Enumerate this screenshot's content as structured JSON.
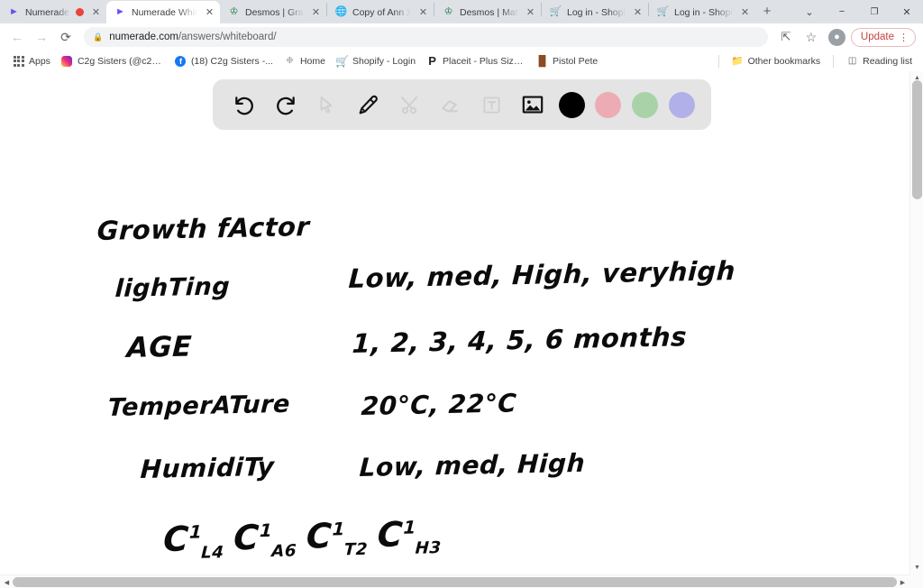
{
  "browser": {
    "tabs": [
      {
        "title": "Numerade",
        "favicon": "numerade-icon",
        "active": false,
        "recording": true
      },
      {
        "title": "Numerade White",
        "favicon": "numerade-icon",
        "active": true,
        "recording": false
      },
      {
        "title": "Desmos | Graphi",
        "favicon": "desmos-icon",
        "active": false,
        "recording": false
      },
      {
        "title": "Copy of Ann Xav",
        "favicon": "globe-icon",
        "active": false,
        "recording": false
      },
      {
        "title": "Desmos | Matrix",
        "favicon": "desmos-icon",
        "active": false,
        "recording": false
      },
      {
        "title": "Log in - Shopify",
        "favicon": "shopify-icon",
        "active": false,
        "recording": false
      },
      {
        "title": "Log in - Shopify",
        "favicon": "shopify-icon",
        "active": false,
        "recording": false
      }
    ],
    "new_tab_label": "+",
    "window_controls": {
      "tab_search": "⌄",
      "minimize": "−",
      "maximize": "❐",
      "close": "✕"
    },
    "nav": {
      "back": "←",
      "forward": "→",
      "reload": "⟳",
      "lock": "🔒",
      "url_host": "numerade.com",
      "url_path": "/answers/whiteboard/",
      "url_full": "numerade.com/answers/whiteboard/",
      "share": "⭣",
      "bookmark_star": "☆",
      "profile": "👤",
      "update_label": "Update",
      "menu_dots": "⋮"
    },
    "bookmarks": [
      {
        "label": "Apps",
        "icon": "apps-grid-icon"
      },
      {
        "label": "C2g Sisters (@c2g...",
        "icon": "instagram-icon"
      },
      {
        "label": "(18) C2g Sisters -...",
        "icon": "facebook-icon"
      },
      {
        "label": "Home",
        "icon": "home-icon"
      },
      {
        "label": "Shopify - Login",
        "icon": "shopify-icon"
      },
      {
        "label": "Placeit - Plus Size...",
        "icon": "placeit-icon"
      },
      {
        "label": "Pistol Pete",
        "icon": "pistol-pete-icon"
      }
    ],
    "bookmarks_right": [
      {
        "label": "Other bookmarks",
        "icon": "folder-icon"
      },
      {
        "label": "Reading list",
        "icon": "reading-list-icon"
      }
    ]
  },
  "whiteboard": {
    "toolbar": {
      "tools": [
        {
          "name": "undo",
          "label": "Undo",
          "enabled": true
        },
        {
          "name": "redo",
          "label": "Redo",
          "enabled": true
        },
        {
          "name": "select",
          "label": "Select",
          "enabled": false
        },
        {
          "name": "pencil",
          "label": "Pencil",
          "enabled": true
        },
        {
          "name": "shapes",
          "label": "Shapes",
          "enabled": false
        },
        {
          "name": "eraser",
          "label": "Eraser",
          "enabled": false
        },
        {
          "name": "text",
          "label": "Text",
          "enabled": false
        },
        {
          "name": "image",
          "label": "Image",
          "enabled": true
        }
      ],
      "colors": [
        {
          "name": "black",
          "hex": "#000000",
          "selected": true
        },
        {
          "name": "pink",
          "hex": "#edacb3",
          "selected": false
        },
        {
          "name": "green",
          "hex": "#a9d2a9",
          "selected": false
        },
        {
          "name": "purple",
          "hex": "#b2b0e8",
          "selected": false
        }
      ]
    },
    "handwriting": {
      "title": "Growth fActor",
      "rows": [
        {
          "factor": "lighTing",
          "values": "Low, med, High, veryhigh"
        },
        {
          "factor": "AGE",
          "values": "1, 2, 3, 4, 5, 6 months"
        },
        {
          "factor": "TemperATure",
          "values": "20°C, 22°C"
        },
        {
          "factor": "HumidiTy",
          "values": "Low, med, High"
        }
      ],
      "formula_terms": [
        {
          "base": "C",
          "sub": "L",
          "sup": "1",
          "count": "4"
        },
        {
          "base": "C",
          "sub": "A",
          "sup": "1",
          "count": "6"
        },
        {
          "base": "C",
          "sub": "T",
          "sup": "1",
          "count": "2"
        },
        {
          "base": "C",
          "sub": "H",
          "sup": "1",
          "count": "3"
        }
      ]
    }
  },
  "scrollbars": {
    "v_up": "▲",
    "v_down": "▼",
    "h_left": "◀",
    "h_right": "▶"
  }
}
